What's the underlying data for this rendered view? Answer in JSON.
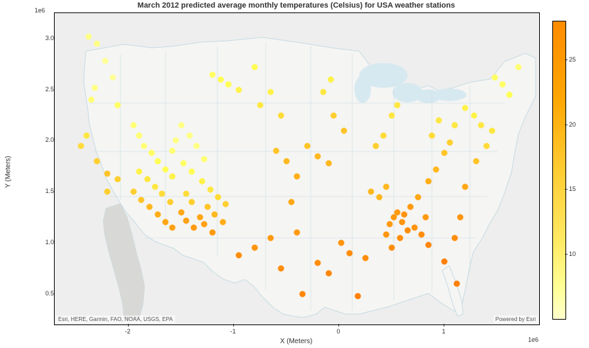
{
  "title": "March 2012 predicted average monthly temperatures (Celsius) for USA weather stations",
  "xlabel": "X (Meters)",
  "ylabel": "Y (Meters)",
  "x_scale_label": "1e6",
  "y_scale_label": "1e6",
  "attribution_left": "Esri, HERE, Garmin, FAO, NOAA, USGS, EPA",
  "attribution_right": "Powered by Esri",
  "x_ticks": [
    -2,
    -1,
    0,
    1
  ],
  "y_ticks": [
    0.5,
    1.0,
    1.5,
    2.0,
    2.5,
    3.0
  ],
  "x_range": [
    -2.7,
    1.9
  ],
  "y_range": [
    0.2,
    3.25
  ],
  "colorbar": {
    "ticks": [
      10,
      15,
      20,
      25
    ],
    "range": [
      5,
      28
    ]
  },
  "chart_data": {
    "type": "scatter",
    "title": "March 2012 predicted average monthly temperatures (Celsius) for USA weather stations",
    "xlabel": "X (Meters)",
    "ylabel": "Y (Meters)",
    "x_unit_multiplier": 1000000,
    "y_unit_multiplier": 1000000,
    "color_field": "temp_celsius",
    "color_range": [
      5,
      28
    ],
    "points": [
      {
        "x": -2.38,
        "y": 3.02,
        "t": 9
      },
      {
        "x": -2.3,
        "y": 2.95,
        "t": 9
      },
      {
        "x": -2.22,
        "y": 2.78,
        "t": 8
      },
      {
        "x": -2.15,
        "y": 2.62,
        "t": 8
      },
      {
        "x": -2.32,
        "y": 2.52,
        "t": 9
      },
      {
        "x": -2.35,
        "y": 2.4,
        "t": 10
      },
      {
        "x": -2.1,
        "y": 2.35,
        "t": 11
      },
      {
        "x": -2.4,
        "y": 2.05,
        "t": 14
      },
      {
        "x": -2.45,
        "y": 1.95,
        "t": 15
      },
      {
        "x": -2.3,
        "y": 1.8,
        "t": 16
      },
      {
        "x": -2.2,
        "y": 1.68,
        "t": 17
      },
      {
        "x": -2.1,
        "y": 1.62,
        "t": 16
      },
      {
        "x": -2.2,
        "y": 1.5,
        "t": 16
      },
      {
        "x": -1.95,
        "y": 2.15,
        "t": 10
      },
      {
        "x": -1.9,
        "y": 2.05,
        "t": 10
      },
      {
        "x": -1.85,
        "y": 1.95,
        "t": 10
      },
      {
        "x": -1.78,
        "y": 1.88,
        "t": 11
      },
      {
        "x": -1.72,
        "y": 1.8,
        "t": 12
      },
      {
        "x": -1.65,
        "y": 1.72,
        "t": 12
      },
      {
        "x": -1.58,
        "y": 1.65,
        "t": 13
      },
      {
        "x": -1.9,
        "y": 1.7,
        "t": 13
      },
      {
        "x": -1.82,
        "y": 1.62,
        "t": 14
      },
      {
        "x": -1.75,
        "y": 1.55,
        "t": 14
      },
      {
        "x": -1.68,
        "y": 1.48,
        "t": 15
      },
      {
        "x": -1.6,
        "y": 1.4,
        "t": 16
      },
      {
        "x": -1.95,
        "y": 1.5,
        "t": 16
      },
      {
        "x": -1.88,
        "y": 1.42,
        "t": 17
      },
      {
        "x": -1.8,
        "y": 1.35,
        "t": 18
      },
      {
        "x": -1.72,
        "y": 1.28,
        "t": 19
      },
      {
        "x": -1.65,
        "y": 1.2,
        "t": 20
      },
      {
        "x": -1.58,
        "y": 1.15,
        "t": 21
      },
      {
        "x": -1.5,
        "y": 1.3,
        "t": 20
      },
      {
        "x": -1.45,
        "y": 1.22,
        "t": 21
      },
      {
        "x": -1.38,
        "y": 1.15,
        "t": 22
      },
      {
        "x": -1.28,
        "y": 1.82,
        "t": 10
      },
      {
        "x": -1.35,
        "y": 1.95,
        "t": 9
      },
      {
        "x": -1.42,
        "y": 2.05,
        "t": 9
      },
      {
        "x": -1.5,
        "y": 2.15,
        "t": 9
      },
      {
        "x": -1.55,
        "y": 2.0,
        "t": 9
      },
      {
        "x": -1.58,
        "y": 1.9,
        "t": 10
      },
      {
        "x": -1.48,
        "y": 1.78,
        "t": 11
      },
      {
        "x": -1.4,
        "y": 1.7,
        "t": 12
      },
      {
        "x": -1.3,
        "y": 1.6,
        "t": 13
      },
      {
        "x": -1.22,
        "y": 1.52,
        "t": 14
      },
      {
        "x": -1.15,
        "y": 1.45,
        "t": 15
      },
      {
        "x": -1.08,
        "y": 1.38,
        "t": 16
      },
      {
        "x": -1.25,
        "y": 1.35,
        "t": 17
      },
      {
        "x": -1.18,
        "y": 1.28,
        "t": 18
      },
      {
        "x": -1.1,
        "y": 1.2,
        "t": 19
      },
      {
        "x": -1.32,
        "y": 1.25,
        "t": 20
      },
      {
        "x": -1.28,
        "y": 1.18,
        "t": 21
      },
      {
        "x": -1.2,
        "y": 1.1,
        "t": 22
      },
      {
        "x": -1.45,
        "y": 1.48,
        "t": 15
      },
      {
        "x": -1.4,
        "y": 1.4,
        "t": 16
      },
      {
        "x": -1.05,
        "y": 2.55,
        "t": 12
      },
      {
        "x": -1.12,
        "y": 2.6,
        "t": 12
      },
      {
        "x": -1.2,
        "y": 2.65,
        "t": 11
      },
      {
        "x": -0.95,
        "y": 2.5,
        "t": 13
      },
      {
        "x": -0.8,
        "y": 2.72,
        "t": 12
      },
      {
        "x": -0.75,
        "y": 2.35,
        "t": 14
      },
      {
        "x": -0.65,
        "y": 2.48,
        "t": 13
      },
      {
        "x": -0.55,
        "y": 2.25,
        "t": 15
      },
      {
        "x": -0.6,
        "y": 1.9,
        "t": 17
      },
      {
        "x": -0.5,
        "y": 1.8,
        "t": 18
      },
      {
        "x": -0.4,
        "y": 1.65,
        "t": 19
      },
      {
        "x": -0.3,
        "y": 1.95,
        "t": 17
      },
      {
        "x": -0.2,
        "y": 1.85,
        "t": 18
      },
      {
        "x": -0.1,
        "y": 1.78,
        "t": 18
      },
      {
        "x": -0.15,
        "y": 2.48,
        "t": 14
      },
      {
        "x": -0.08,
        "y": 2.6,
        "t": 13
      },
      {
        "x": -0.05,
        "y": 2.25,
        "t": 16
      },
      {
        "x": 0.05,
        "y": 2.1,
        "t": 17
      },
      {
        "x": -0.45,
        "y": 1.4,
        "t": 20
      },
      {
        "x": -0.4,
        "y": 1.1,
        "t": 22
      },
      {
        "x": -0.65,
        "y": 1.05,
        "t": 22
      },
      {
        "x": -0.8,
        "y": 0.95,
        "t": 23
      },
      {
        "x": -0.95,
        "y": 0.88,
        "t": 24
      },
      {
        "x": -0.55,
        "y": 0.75,
        "t": 24
      },
      {
        "x": -0.35,
        "y": 0.5,
        "t": 25
      },
      {
        "x": -0.2,
        "y": 0.8,
        "t": 24
      },
      {
        "x": -0.1,
        "y": 0.7,
        "t": 25
      },
      {
        "x": 0.02,
        "y": 1.0,
        "t": 23
      },
      {
        "x": 0.1,
        "y": 0.9,
        "t": 24
      },
      {
        "x": 0.18,
        "y": 0.48,
        "t": 26
      },
      {
        "x": 0.25,
        "y": 0.85,
        "t": 24
      },
      {
        "x": 0.3,
        "y": 1.5,
        "t": 18
      },
      {
        "x": 0.38,
        "y": 1.45,
        "t": 18
      },
      {
        "x": 0.45,
        "y": 1.55,
        "t": 18
      },
      {
        "x": 0.35,
        "y": 1.95,
        "t": 16
      },
      {
        "x": 0.42,
        "y": 2.05,
        "t": 15
      },
      {
        "x": 0.5,
        "y": 2.25,
        "t": 14
      },
      {
        "x": 0.55,
        "y": 2.35,
        "t": 14
      },
      {
        "x": 0.48,
        "y": 1.18,
        "t": 22
      },
      {
        "x": 0.52,
        "y": 1.25,
        "t": 22
      },
      {
        "x": 0.55,
        "y": 1.3,
        "t": 22
      },
      {
        "x": 0.6,
        "y": 1.2,
        "t": 23
      },
      {
        "x": 0.65,
        "y": 1.12,
        "t": 24
      },
      {
        "x": 0.58,
        "y": 1.05,
        "t": 24
      },
      {
        "x": 0.62,
        "y": 1.28,
        "t": 23
      },
      {
        "x": 0.68,
        "y": 1.35,
        "t": 22
      },
      {
        "x": 0.45,
        "y": 1.08,
        "t": 23
      },
      {
        "x": 0.5,
        "y": 0.95,
        "t": 24
      },
      {
        "x": 0.72,
        "y": 1.15,
        "t": 23
      },
      {
        "x": 0.78,
        "y": 1.08,
        "t": 24
      },
      {
        "x": 0.85,
        "y": 0.98,
        "t": 25
      },
      {
        "x": 0.82,
        "y": 1.25,
        "t": 22
      },
      {
        "x": 0.75,
        "y": 1.45,
        "t": 20
      },
      {
        "x": 0.85,
        "y": 1.6,
        "t": 19
      },
      {
        "x": 0.92,
        "y": 1.72,
        "t": 18
      },
      {
        "x": 1.0,
        "y": 1.88,
        "t": 17
      },
      {
        "x": 1.05,
        "y": 1.98,
        "t": 16
      },
      {
        "x": 0.95,
        "y": 2.2,
        "t": 14
      },
      {
        "x": 0.88,
        "y": 2.05,
        "t": 15
      },
      {
        "x": 1.1,
        "y": 2.15,
        "t": 14
      },
      {
        "x": 1.2,
        "y": 2.32,
        "t": 13
      },
      {
        "x": 1.28,
        "y": 2.25,
        "t": 13
      },
      {
        "x": 1.35,
        "y": 2.15,
        "t": 14
      },
      {
        "x": 1.45,
        "y": 2.1,
        "t": 14
      },
      {
        "x": 1.4,
        "y": 1.95,
        "t": 15
      },
      {
        "x": 1.3,
        "y": 1.8,
        "t": 17
      },
      {
        "x": 1.2,
        "y": 1.55,
        "t": 20
      },
      {
        "x": 1.15,
        "y": 1.25,
        "t": 23
      },
      {
        "x": 1.1,
        "y": 1.05,
        "t": 24
      },
      {
        "x": 1.0,
        "y": 0.82,
        "t": 26
      },
      {
        "x": 1.12,
        "y": 0.6,
        "t": 26
      },
      {
        "x": 1.48,
        "y": 2.62,
        "t": 11
      },
      {
        "x": 1.55,
        "y": 2.55,
        "t": 11
      },
      {
        "x": 1.62,
        "y": 2.45,
        "t": 12
      },
      {
        "x": 1.7,
        "y": 2.72,
        "t": 10
      }
    ]
  }
}
